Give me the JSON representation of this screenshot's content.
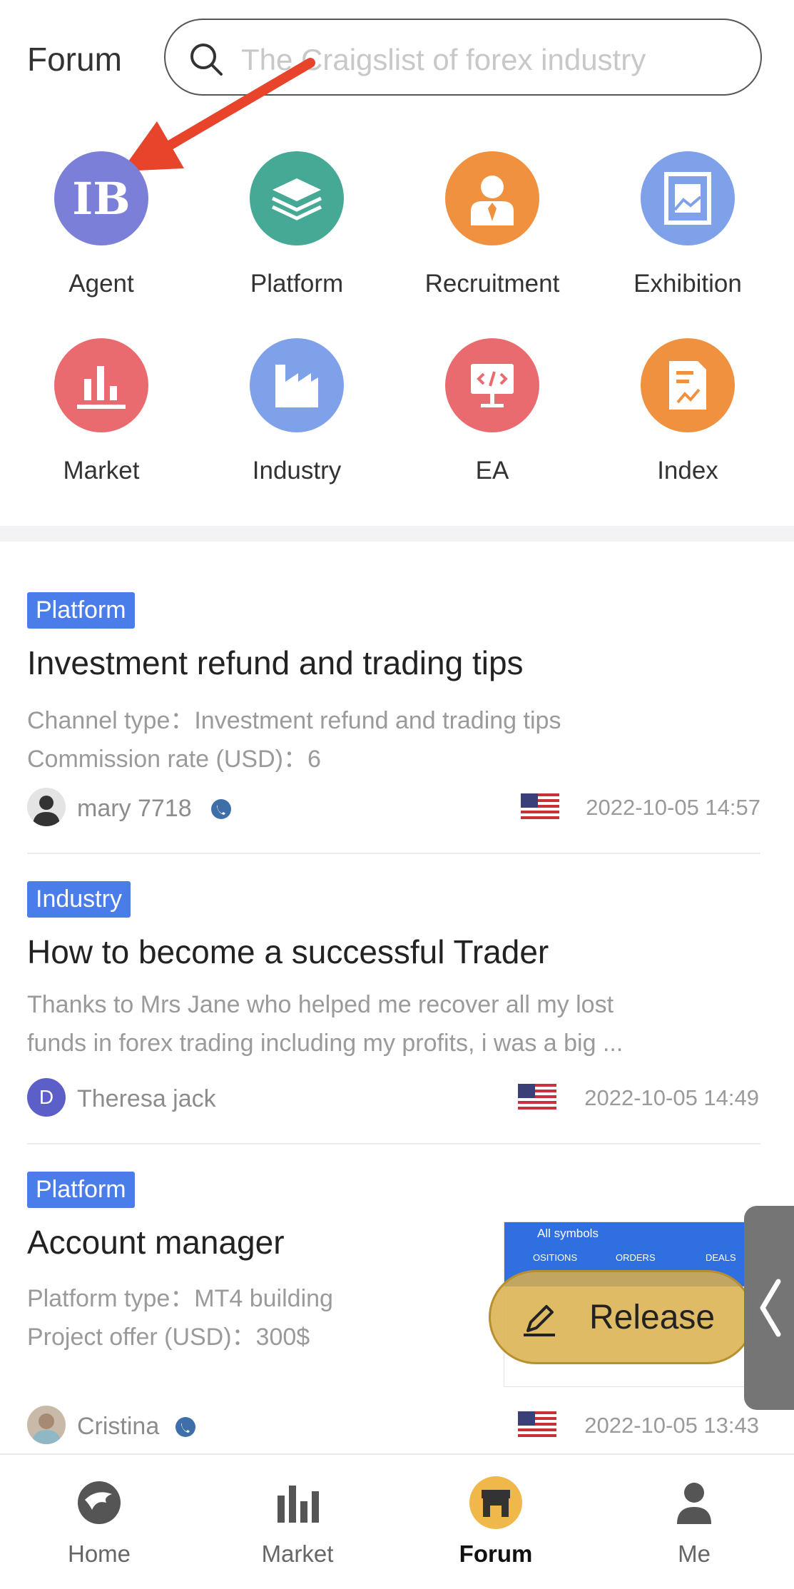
{
  "header": {
    "title": "Forum",
    "search_placeholder": "The Craigslist of forex industry"
  },
  "categories": [
    {
      "label": "Agent",
      "icon": "ib-icon",
      "color": "#7b7fd8"
    },
    {
      "label": "Platform",
      "icon": "layers-icon",
      "color": "#45a996"
    },
    {
      "label": "Recruitment",
      "icon": "person-tie-icon",
      "color": "#f0913f"
    },
    {
      "label": "Exhibition",
      "icon": "picture-frame-icon",
      "color": "#7ea1e9"
    },
    {
      "label": "Market",
      "icon": "bar-chart-icon",
      "color": "#ea6b6f"
    },
    {
      "label": "Industry",
      "icon": "factory-icon",
      "color": "#7ea1e9"
    },
    {
      "label": "EA",
      "icon": "code-monitor-icon",
      "color": "#ea6b6f"
    },
    {
      "label": "Index",
      "icon": "document-chart-icon",
      "color": "#f0913f"
    }
  ],
  "posts": [
    {
      "tag": "Platform",
      "title": "Investment refund and trading tips",
      "line1": "Channel type：Investment refund and trading tips",
      "line2": "Commission rate (USD)：6",
      "author": "mary 7718",
      "date": "2022-10-05 14:57"
    },
    {
      "tag": "Industry",
      "title": "How to become a successful Trader",
      "line1": "Thanks to Mrs Jane who helped me recover all my lost",
      "line2": "funds in forex trading including my profits, i was a big ...",
      "author": "Theresa jack",
      "avatar_letter": "D",
      "date": "2022-10-05 14:49"
    },
    {
      "tag": "Platform",
      "title": "Account manager",
      "line1": "Platform type：MT4 building",
      "line2": "Project offer (USD)：300$",
      "author": "Cristina",
      "date": "2022-10-05 13:43"
    }
  ],
  "thumbnail": {
    "header": "All symbols",
    "col1": "OSITIONS",
    "col2": "ORDERS",
    "col3": "DEALS"
  },
  "release_label": "Release",
  "nav": [
    {
      "label": "Home",
      "icon": "eagle-icon"
    },
    {
      "label": "Market",
      "icon": "bar-chart-icon"
    },
    {
      "label": "Forum",
      "icon": "store-icon",
      "active": true
    },
    {
      "label": "Me",
      "icon": "person-icon"
    }
  ]
}
